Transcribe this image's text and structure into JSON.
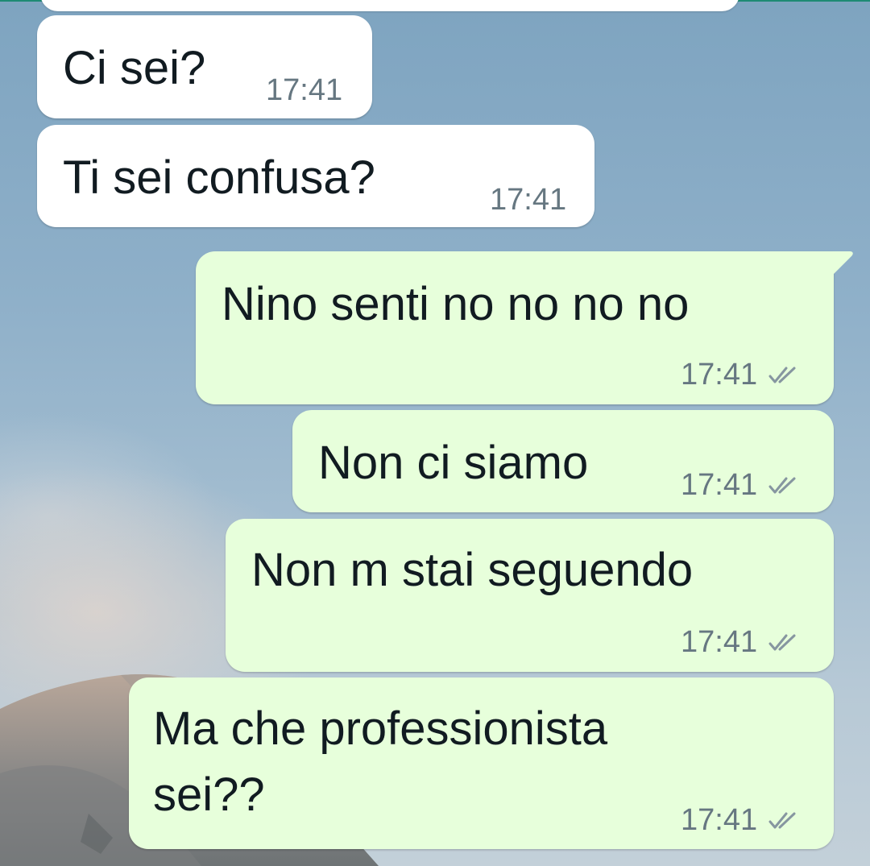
{
  "messages": [
    {
      "id": "in1",
      "direction": "incoming",
      "text": "Ci sei?",
      "time": "17:41"
    },
    {
      "id": "in2",
      "direction": "incoming",
      "text": "Ti sei confusa?",
      "time": "17:41"
    },
    {
      "id": "out1",
      "direction": "outgoing",
      "text": "Nino senti no no no no",
      "time": "17:41",
      "status_icon": "double-check-icon"
    },
    {
      "id": "out2",
      "direction": "outgoing",
      "text": "Non ci siamo",
      "time": "17:41",
      "status_icon": "double-check-icon"
    },
    {
      "id": "out3",
      "direction": "outgoing",
      "text": "Non m stai seguendo",
      "time": "17:41",
      "status_icon": "double-check-icon"
    },
    {
      "id": "out4",
      "direction": "outgoing",
      "text_line1": "Ma che professionista",
      "text_line2": "sei??",
      "time": "17:41",
      "status_icon": "double-check-icon"
    }
  ],
  "colors": {
    "incoming_bubble": "#ffffff",
    "outgoing_bubble": "#e7ffdb",
    "message_text": "#111b21",
    "meta_text": "#667781",
    "header_accent": "#1e8a74"
  }
}
